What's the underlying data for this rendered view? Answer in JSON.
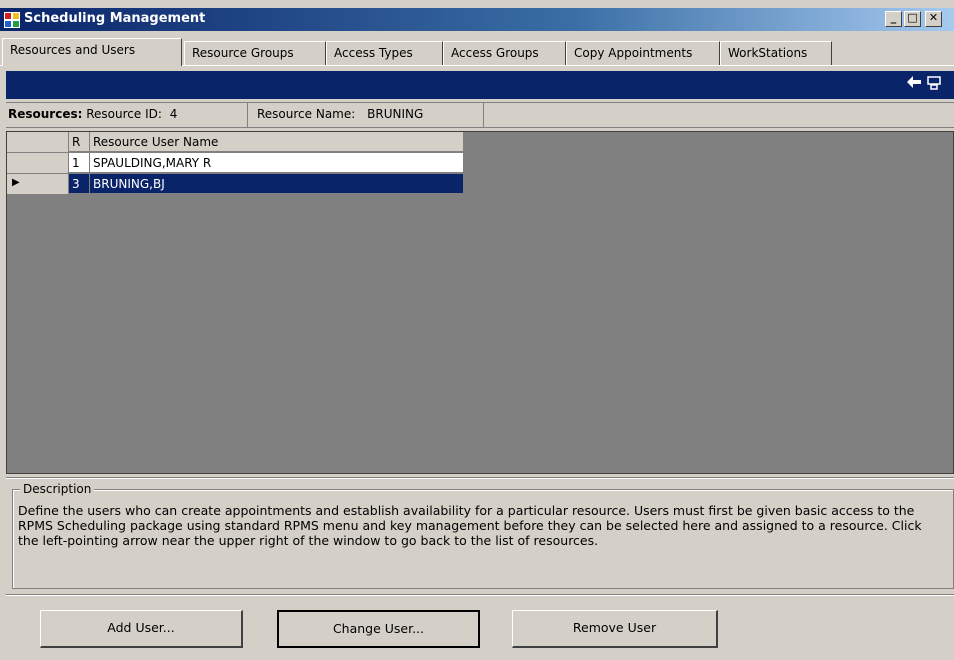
{
  "window": {
    "title": "Scheduling Management",
    "controls": [
      "_",
      "□",
      "✕"
    ]
  },
  "tabs": [
    {
      "label": "Resources and Users",
      "active": true
    },
    {
      "label": "Resource Groups",
      "active": false
    },
    {
      "label": "Access Types",
      "active": false
    },
    {
      "label": "Access Groups",
      "active": false
    },
    {
      "label": "Copy Appointments",
      "active": false
    },
    {
      "label": "WorkStations",
      "active": false
    }
  ],
  "toolbar": {
    "icons": [
      "back-arrow-icon",
      "print-icon"
    ],
    "back_glyph": "🡠"
  },
  "info": {
    "resources_label": "Resources:",
    "resource_id_label": "Resource ID:",
    "resource_id_value": "4",
    "resource_name_label": "Resource Name:",
    "resource_name_value": "BRUNING"
  },
  "grid": {
    "columns": [
      "R",
      "Resource User Name"
    ],
    "rows": [
      {
        "id": "1",
        "name": "SPAULDING,MARY R",
        "selected": false
      },
      {
        "id": "3",
        "name": "BRUNING,BJ",
        "selected": true
      }
    ],
    "current_row_glyph": "▶"
  },
  "description": {
    "legend": "Description",
    "text": "Define the users who can create appointments and establish availability for a particular resource.  Users must first be given basic access to the RPMS Scheduling package using standard RPMS menu and key management before they can be selected here and assigned to a resource.  Click the left-pointing arrow near the upper right of the window to go back to the list of resources."
  },
  "buttons": {
    "add": "Add User...",
    "change": "Change User...",
    "remove": "Remove User"
  },
  "colors": {
    "navy": "#0a246a",
    "face": "#d4d0c8",
    "grid_bg": "#808080"
  }
}
